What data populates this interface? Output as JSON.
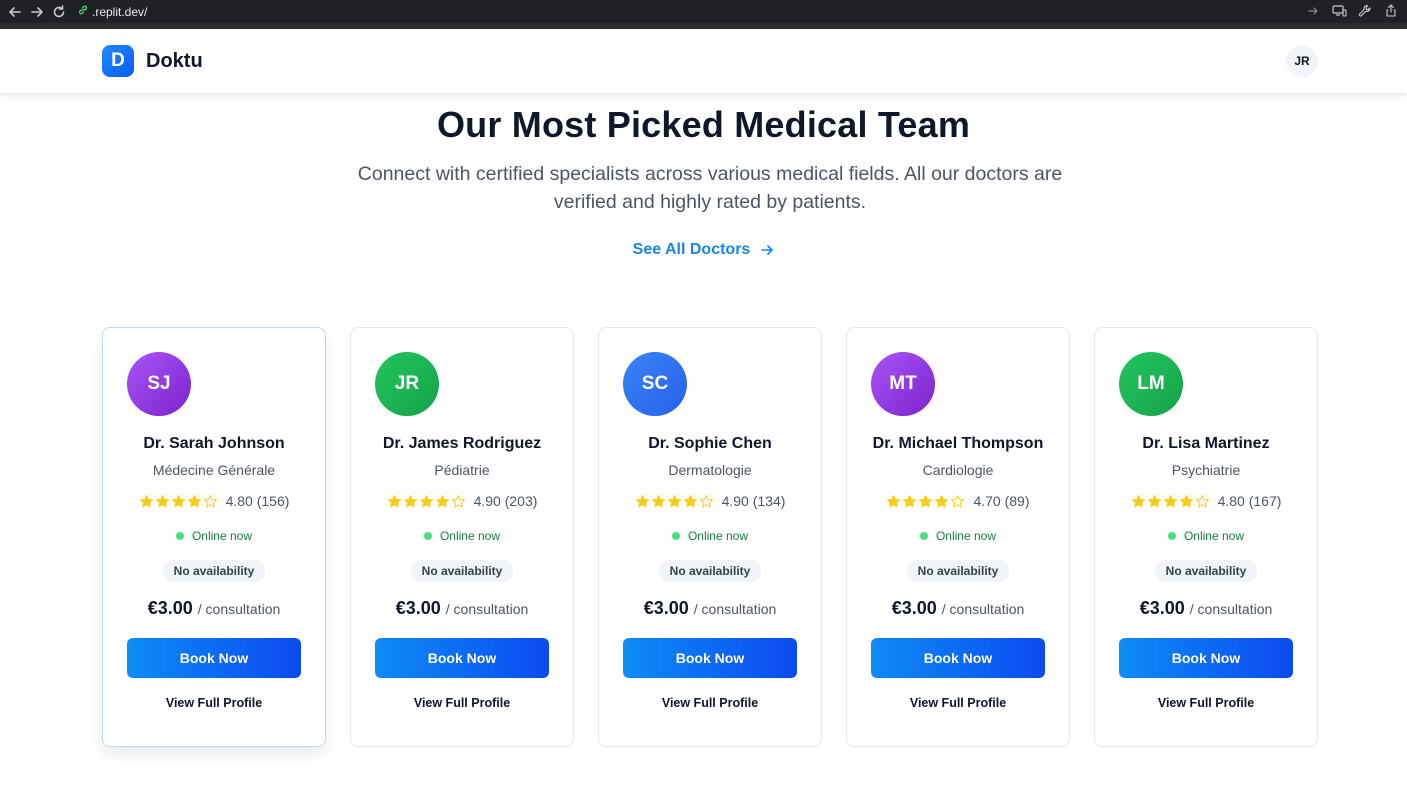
{
  "browser": {
    "url_domain": ".replit.dev/"
  },
  "header": {
    "logo_letter": "D",
    "brand": "Doktu",
    "user_initials": "JR"
  },
  "section": {
    "title": "Our Most Picked Medical Team",
    "subtitle": "Connect with certified specialists across various medical fields. All our doctors are verified and highly rated by patients.",
    "see_all_label": "See All Doctors"
  },
  "colors": {
    "primary": "#0c6cf2",
    "link": "#1a86e0",
    "star": "#facc15",
    "online": "#4ade80"
  },
  "doctors": [
    {
      "initials": "SJ",
      "name": "Dr. Sarah Johnson",
      "specialty": "Médecine Générale",
      "stars_filled": 4,
      "rating_text": "4.80 (156)",
      "status": "Online now",
      "availability": "No availability",
      "price": "€3.00",
      "price_unit": "/ consultation",
      "book_label": "Book Now",
      "profile_label": "View Full Profile",
      "avatar_color_from": "#a855f7",
      "avatar_color_to": "#7e22ce"
    },
    {
      "initials": "JR",
      "name": "Dr. James Rodriguez",
      "specialty": "Pédiatrie",
      "stars_filled": 4,
      "rating_text": "4.90 (203)",
      "status": "Online now",
      "availability": "No availability",
      "price": "€3.00",
      "price_unit": "/ consultation",
      "book_label": "Book Now",
      "profile_label": "View Full Profile",
      "avatar_color_from": "#22c55e",
      "avatar_color_to": "#15a34a"
    },
    {
      "initials": "SC",
      "name": "Dr. Sophie Chen",
      "specialty": "Dermatologie",
      "stars_filled": 4,
      "rating_text": "4.90 (134)",
      "status": "Online now",
      "availability": "No availability",
      "price": "€3.00",
      "price_unit": "/ consultation",
      "book_label": "Book Now",
      "profile_label": "View Full Profile",
      "avatar_color_from": "#3b82f6",
      "avatar_color_to": "#2563eb"
    },
    {
      "initials": "MT",
      "name": "Dr. Michael Thompson",
      "specialty": "Cardiologie",
      "stars_filled": 4,
      "rating_text": "4.70 (89)",
      "status": "Online now",
      "availability": "No availability",
      "price": "€3.00",
      "price_unit": "/ consultation",
      "book_label": "Book Now",
      "profile_label": "View Full Profile",
      "avatar_color_from": "#a855f7",
      "avatar_color_to": "#7e22ce"
    },
    {
      "initials": "LM",
      "name": "Dr. Lisa Martinez",
      "specialty": "Psychiatrie",
      "stars_filled": 4,
      "rating_text": "4.80 (167)",
      "status": "Online now",
      "availability": "No availability",
      "price": "€3.00",
      "price_unit": "/ consultation",
      "book_label": "Book Now",
      "profile_label": "View Full Profile",
      "avatar_color_from": "#22c55e",
      "avatar_color_to": "#15a34a"
    }
  ]
}
